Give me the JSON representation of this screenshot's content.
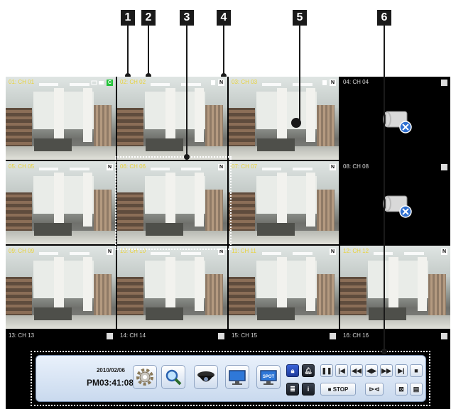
{
  "callouts": [
    "1",
    "2",
    "3",
    "4",
    "5",
    "6"
  ],
  "channels": [
    {
      "label": "01: CH 01",
      "type": "live",
      "flag": "C"
    },
    {
      "label": "02: CH 02",
      "type": "live",
      "flag": "N"
    },
    {
      "label": "03: CH 03",
      "type": "live",
      "flag": "N"
    },
    {
      "label": "04: CH 04",
      "type": "nosignal",
      "flag": ""
    },
    {
      "label": "05: CH 05",
      "type": "live",
      "flag": "N"
    },
    {
      "label": "06: CH 06",
      "type": "live",
      "flag": "N"
    },
    {
      "label": "07: CH 07",
      "type": "live",
      "flag": "N"
    },
    {
      "label": "08: CH 08",
      "type": "nosignal",
      "flag": ""
    },
    {
      "label": "09: CH 09",
      "type": "live",
      "flag": "N"
    },
    {
      "label": "10: CH 10",
      "type": "live",
      "flag": "N"
    },
    {
      "label": "11: CH 11",
      "type": "live",
      "flag": "N"
    },
    {
      "label": "12: CH 12",
      "type": "live",
      "flag": "N"
    },
    {
      "label": "13: CH 13",
      "type": "empty",
      "flag": ""
    },
    {
      "label": "14: CH 14",
      "type": "empty",
      "flag": ""
    },
    {
      "label": "15: CH 15",
      "type": "empty",
      "flag": ""
    },
    {
      "label": "16: CH 16",
      "type": "empty",
      "flag": ""
    }
  ],
  "toolbar": {
    "date": "2010/02/06",
    "time": "PM03:41:08",
    "stop_label": "■ STOP",
    "buttons": [
      "gear-icon",
      "search-icon",
      "dome-camera-icon",
      "monitor-icon",
      "spot-monitor-icon"
    ],
    "spot_text": "SPOT",
    "small_buttons": [
      "lock-icon",
      "bell-icon",
      "list-icon",
      "info-icon",
      "pause-icon",
      "skip-back-icon",
      "rewind-icon",
      "frame-step-icon",
      "fast-forward-icon",
      "skip-forward-icon",
      "stop-square-icon",
      "zoom-icon",
      "pip-icon",
      "menu-icon"
    ]
  },
  "colors": {
    "label_live": "#e8d23a",
    "label_idle": "#d8d8d8",
    "flag_c": "#24c43a",
    "toolbar_top": "#e9f1fb",
    "toolbar_bottom": "#c9d9ee"
  }
}
